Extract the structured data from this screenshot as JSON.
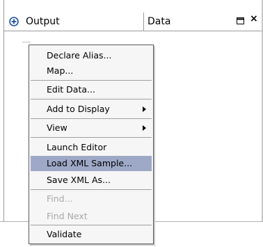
{
  "header": {
    "col_output": "Output",
    "col_data": "Data",
    "close_label": "×"
  },
  "context_menu": {
    "items": [
      {
        "label": "Declare Alias..."
      },
      {
        "label": "Map..."
      },
      {
        "label": "Edit Data..."
      },
      {
        "label": "Add to Display"
      },
      {
        "label": "View"
      },
      {
        "label": "Launch Editor"
      },
      {
        "label": "Load XML Sample..."
      },
      {
        "label": "Save XML As..."
      },
      {
        "label": "Find..."
      },
      {
        "label": "Find Next"
      },
      {
        "label": "Validate"
      }
    ]
  }
}
